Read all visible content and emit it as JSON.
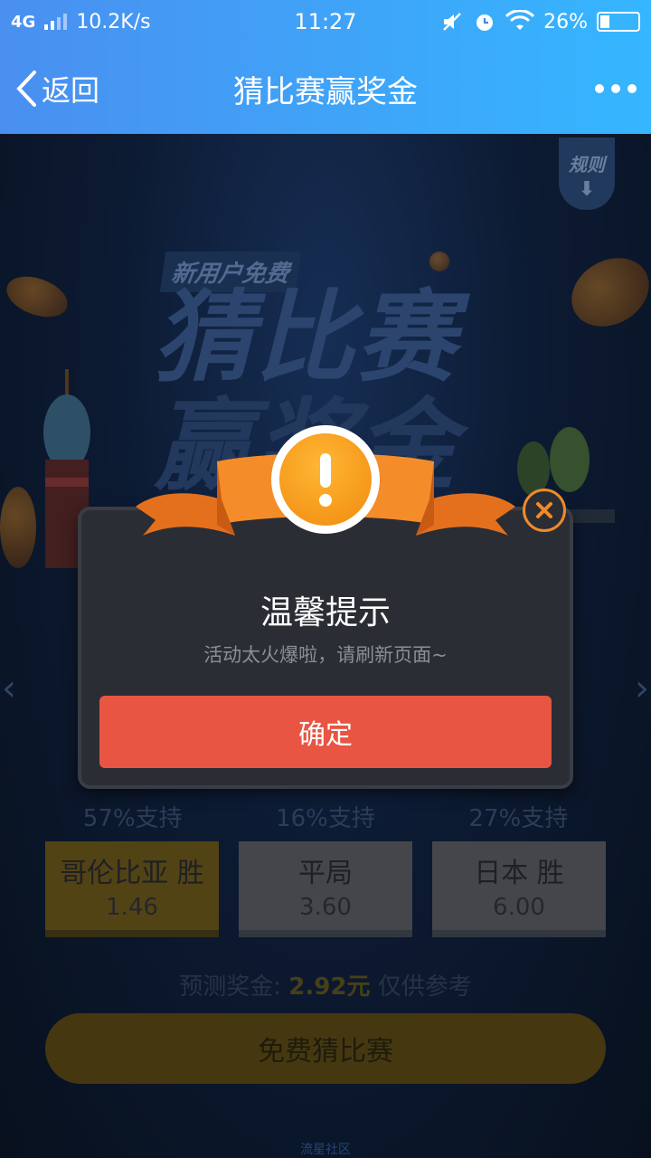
{
  "status_bar": {
    "network": "4G",
    "speed": "10.2K/s",
    "time": "11:27",
    "battery": "26%",
    "battery_level": 0.26,
    "icons": [
      "signal-icon",
      "mute-icon",
      "alarm-icon",
      "wifi-icon",
      "battery-icon"
    ]
  },
  "nav": {
    "back_label": "返回",
    "title": "猜比赛赢奖金",
    "more_icon": "more-dots-icon"
  },
  "background": {
    "rules_label": "规则",
    "hero_subtitle": "新用户免费",
    "hero_title": "猜比赛",
    "hero_title_line2": "赢奖金",
    "support": [
      "57%支持",
      "16%支持",
      "27%支持"
    ],
    "options": [
      {
        "name": "哥伦比亚 胜",
        "odds": "1.46",
        "selected": true
      },
      {
        "name": "平局",
        "odds": "3.60",
        "selected": false
      },
      {
        "name": "日本 胜",
        "odds": "6.00",
        "selected": false
      }
    ],
    "prize_prefix": "预测奖金:",
    "prize_amount": "2.92元",
    "prize_suffix": "仅供参考",
    "guess_button": "免费猜比赛",
    "footer": "流星社区"
  },
  "dialog": {
    "title": "温馨提示",
    "message": "活动太火爆啦，请刷新页面~",
    "confirm": "确定",
    "icon": "exclamation-icon",
    "close_icon": "close-icon"
  },
  "colors": {
    "nav_gradient_start": "#4a8ff0",
    "nav_gradient_end": "#35b6ff",
    "confirm": "#e85543",
    "badge": "#f08a10",
    "dialog_bg": "#2b2d34"
  }
}
